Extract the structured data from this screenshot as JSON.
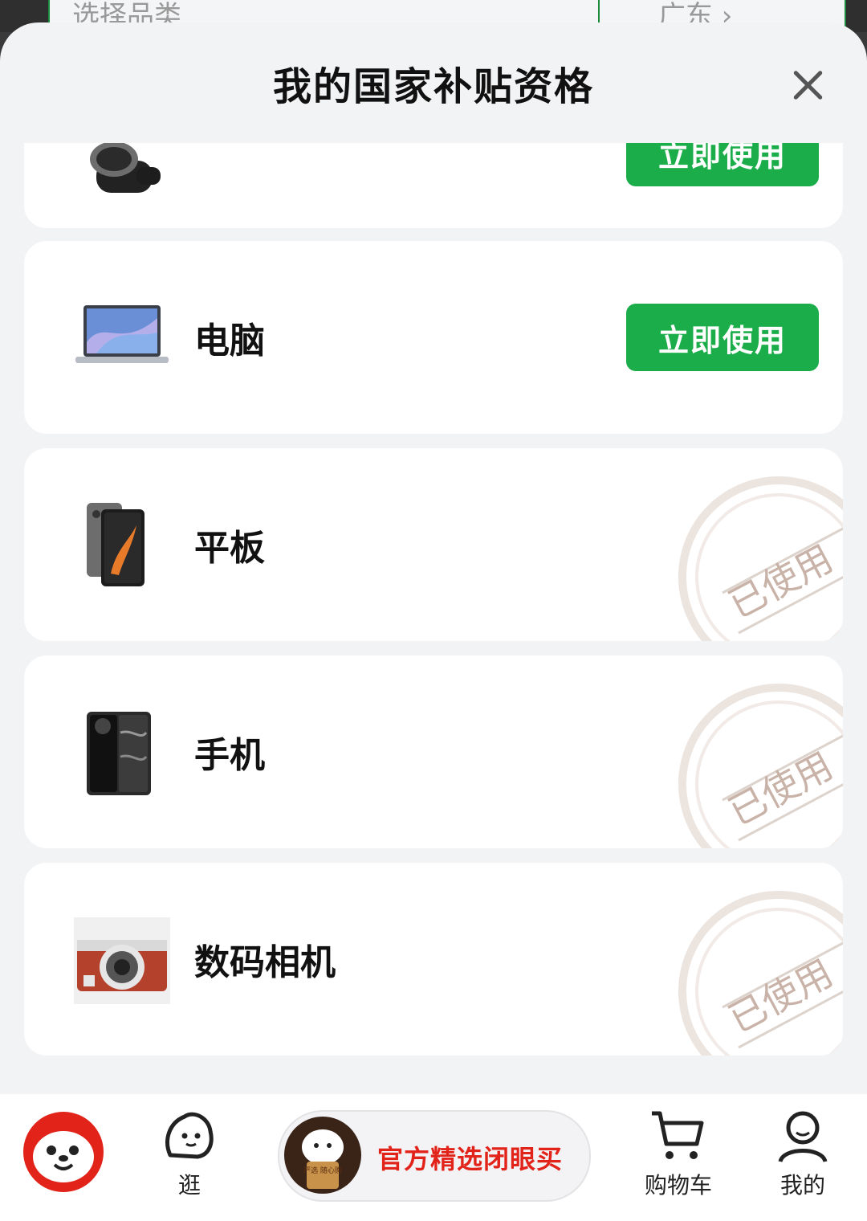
{
  "background": {
    "category_hint": "选择品类",
    "location_hint": "广东 ›"
  },
  "sheet": {
    "title": "我的国家补贴资格"
  },
  "items": [
    {
      "name": "",
      "status": "active",
      "button_label": "立即使用",
      "icon": "smartwatch-image"
    },
    {
      "name": "电脑",
      "status": "active",
      "button_label": "立即使用",
      "icon": "laptop-image"
    },
    {
      "name": "平板",
      "status": "used",
      "stamp_label": "已使用",
      "icon": "tablet-image"
    },
    {
      "name": "手机",
      "status": "used",
      "stamp_label": "已使用",
      "icon": "phone-image"
    },
    {
      "name": "数码相机",
      "status": "used",
      "stamp_label": "已使用",
      "icon": "camera-image"
    }
  ],
  "bottom_nav": {
    "home_icon": "jd-mascot-icon",
    "browse_label": "逛",
    "promo_label": "官方精选闭眼买",
    "promo_badge": "严选 随心购",
    "cart_label": "购物车",
    "mine_label": "我的"
  },
  "colors": {
    "accent_green": "#1aad4a",
    "brand_red": "#e2231a",
    "stamp": "#c9b3a8"
  }
}
